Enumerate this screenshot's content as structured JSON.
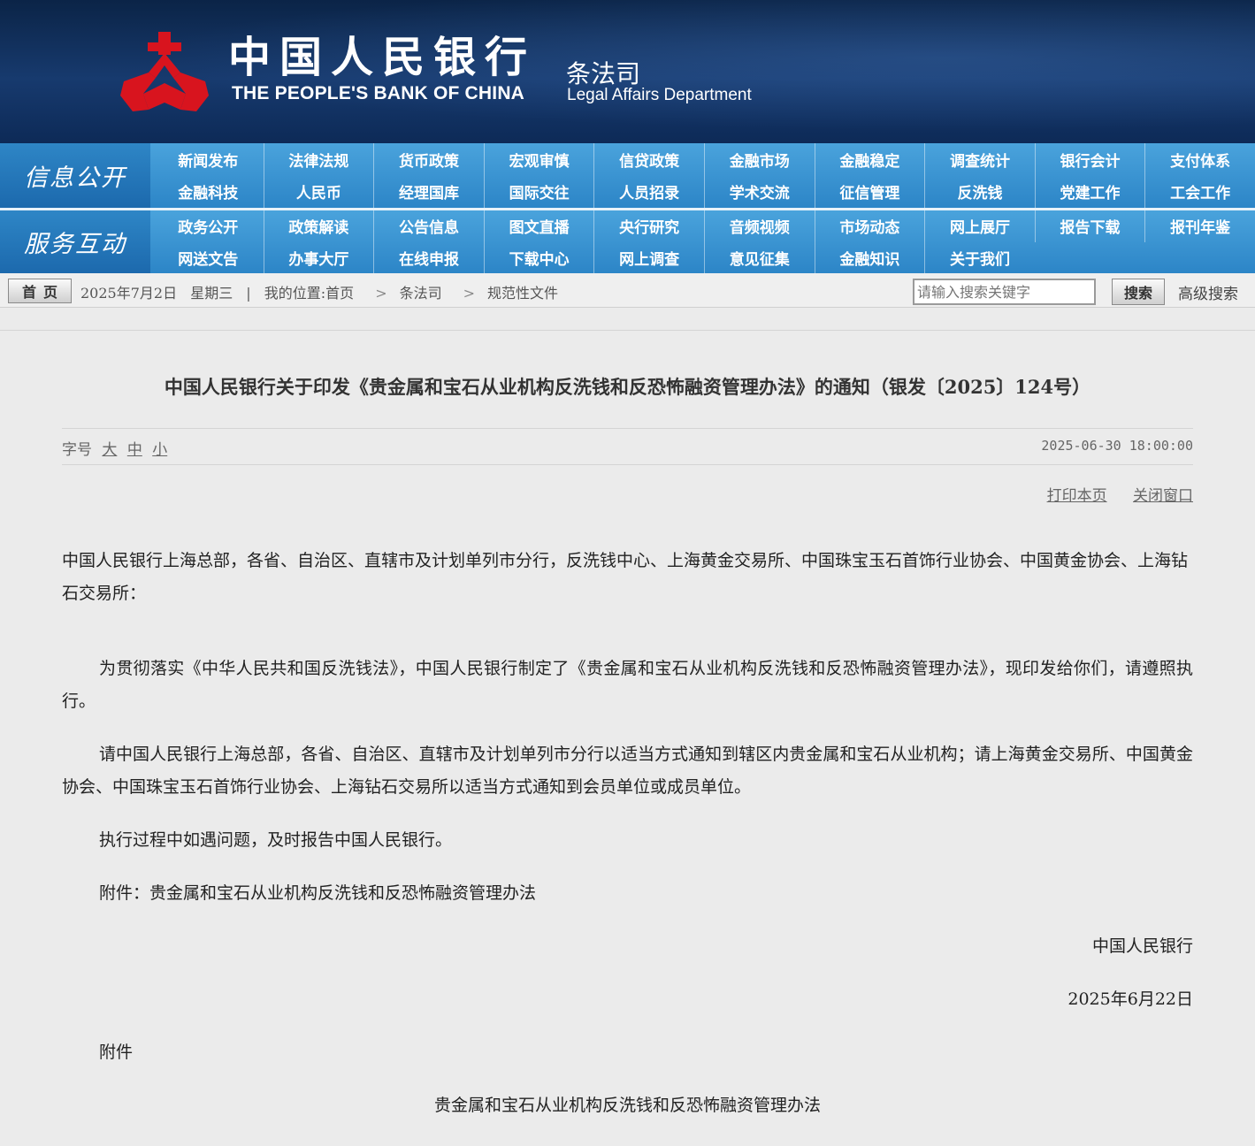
{
  "header": {
    "bank_cn": "中国人民银行",
    "bank_en": "THE PEOPLE'S BANK OF CHINA",
    "dept_cn": "条法司",
    "dept_en": "Legal Affairs Department"
  },
  "nav": {
    "section1_title": "信息公开",
    "section1_items": [
      "新闻发布",
      "法律法规",
      "货币政策",
      "宏观审慎",
      "信贷政策",
      "金融市场",
      "金融稳定",
      "调查统计",
      "银行会计",
      "支付体系",
      "金融科技",
      "人民币",
      "经理国库",
      "国际交往",
      "人员招录",
      "学术交流",
      "征信管理",
      "反洗钱",
      "党建工作",
      "工会工作"
    ],
    "section2_title": "服务互动",
    "section2_items": [
      "政务公开",
      "政策解读",
      "公告信息",
      "图文直播",
      "央行研究",
      "音频视频",
      "市场动态",
      "网上展厅",
      "报告下载",
      "报刊年鉴",
      "网送文告",
      "办事大厅",
      "在线申报",
      "下载中心",
      "网上调查",
      "意见征集",
      "金融知识",
      "关于我们"
    ]
  },
  "locbar": {
    "home": "首页",
    "date": "2025年7月2日",
    "weekday": "星期三",
    "location_label": "我的位置:首页",
    "crumb1": "条法司",
    "crumb2": "规范性文件",
    "search_placeholder": "请输入搜索关键字",
    "search_button": "搜索",
    "advanced": "高级搜索"
  },
  "article": {
    "title": "中国人民银行关于印发《贵金属和宝石从业机构反洗钱和反恐怖融资管理办法》的通知（银发〔2025〕124号）",
    "font_label": "字号",
    "font_large": "大",
    "font_medium": "中",
    "font_small": "小",
    "datetime": "2025-06-30 18:00:00",
    "print": "打印本页",
    "close": "关闭窗口",
    "addressee": "中国人民银行上海总部，各省、自治区、直辖市及计划单列市分行，反洗钱中心、上海黄金交易所、中国珠宝玉石首饰行业协会、中国黄金协会、上海钻石交易所：",
    "para1": "为贯彻落实《中华人民共和国反洗钱法》，中国人民银行制定了《贵金属和宝石从业机构反洗钱和反恐怖融资管理办法》，现印发给你们，请遵照执行。",
    "para2": "请中国人民银行上海总部，各省、自治区、直辖市及计划单列市分行以适当方式通知到辖区内贵金属和宝石从业机构；请上海黄金交易所、中国黄金协会、中国珠宝玉石首饰行业协会、上海钻石交易所以适当方式通知到会员单位或成员单位。",
    "para3": "执行过程中如遇问题，及时报告中国人民银行。",
    "attachment_line": "附件：贵金属和宝石从业机构反洗钱和反恐怖融资管理办法",
    "signer": "中国人民银行",
    "sign_date": "2025年6月22日",
    "attachment_heading": "附件",
    "attachment_title": "贵金属和宝石从业机构反洗钱和反恐怖融资管理办法"
  },
  "colors": {
    "banner": "#173a6e",
    "logo_red": "#d8141e",
    "nav_blue": "#3b96d3",
    "page_bg": "#ebebeb"
  }
}
